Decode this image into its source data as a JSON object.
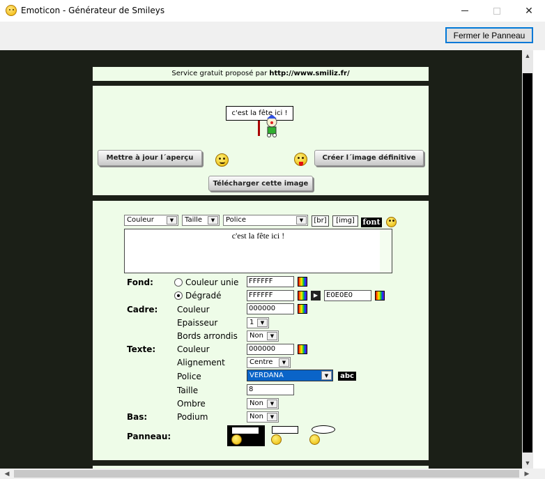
{
  "window": {
    "title": "Emoticon - Générateur de Smileys",
    "close_panel_label": "Fermer le Panneau"
  },
  "service": {
    "prefix": "Service gratuit proposé par",
    "url": "http://www.smiliz.fr/"
  },
  "preview": {
    "sign_text": "c'est la fête ici !",
    "update_label": "Mettre à jour l´aperçu",
    "create_label": "Créer l´image définitive",
    "download_label": "Télécharger cette image"
  },
  "toolbar": {
    "color_select": "Couleur",
    "size_select": "Taille",
    "font_select": "Police",
    "br_label": "[br]",
    "img_label": "[img]",
    "font_icon_label": "font"
  },
  "editor_text": "c'est la fête ici !",
  "form": {
    "fond_label": "Fond:",
    "couleur_unie_label": "Couleur unie",
    "couleur_unie_value": "FFFFFF",
    "degrade_label": "Dégradé",
    "degrade_value1": "FFFFFF",
    "degrade_value2": "E0E0E0",
    "fond_mode": "Dégradé",
    "cadre_label": "Cadre:",
    "cadre_couleur_label": "Couleur",
    "cadre_couleur_value": "000000",
    "epaisseur_label": "Epaisseur",
    "epaisseur_value": "1",
    "bords_label": "Bords arrondis",
    "bords_value": "Non",
    "texte_label": "Texte:",
    "texte_couleur_label": "Couleur",
    "texte_couleur_value": "000000",
    "alignement_label": "Alignement",
    "alignement_value": "Centre",
    "police_label": "Police",
    "police_value": "VERDANA",
    "abc_label": "abc",
    "taille_label": "Taille",
    "taille_value": "8",
    "ombre_label": "Ombre",
    "ombre_value": "Non",
    "bas_label": "Bas:",
    "podium_label": "Podium",
    "podium_value": "Non",
    "panneau_label": "Panneau:"
  }
}
